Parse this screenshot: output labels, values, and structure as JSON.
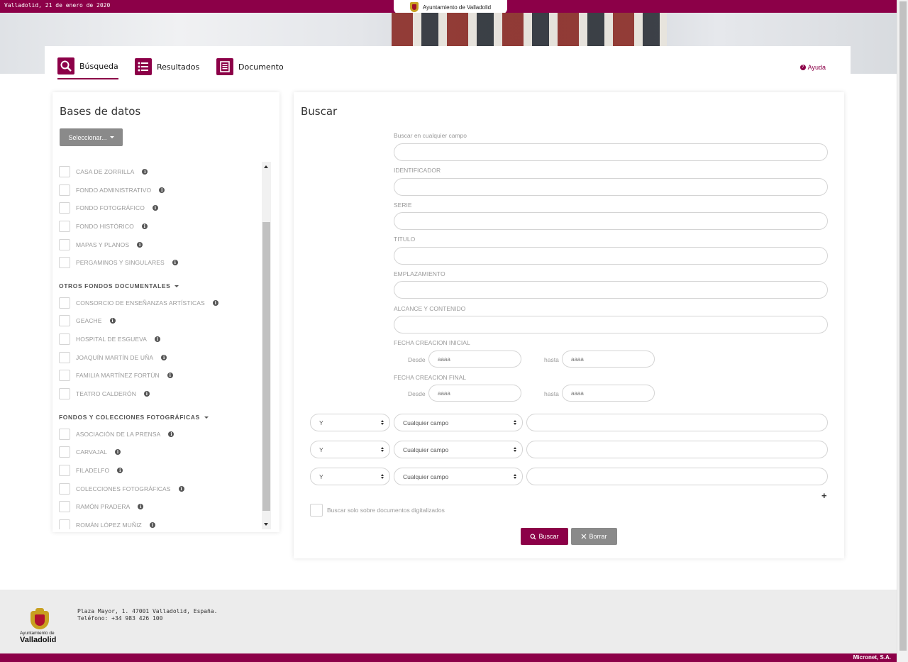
{
  "topbar": {
    "date": "Valladolid, 21 de enero de 2020",
    "site_name": "Ayuntamiento de Valladolid"
  },
  "nav": {
    "tabs": [
      {
        "label": "Búsqueda",
        "icon": "search-icon",
        "active": true
      },
      {
        "label": "Resultados",
        "icon": "list-icon",
        "active": false
      },
      {
        "label": "Documento",
        "icon": "document-icon",
        "active": false
      }
    ],
    "help": "Ayuda"
  },
  "databases": {
    "title": "Bases de datos",
    "select_label": "Seleccionar...",
    "items": [
      "CASA DE ZORRILLA",
      "FONDO ADMINISTRATIVO",
      "FONDO FOTOGRÁFICO",
      "FONDO HISTÓRICO",
      "MAPAS Y PLANOS",
      "PERGAMINOS Y SINGULARES"
    ],
    "groups": [
      {
        "title": "OTROS FONDOS DOCUMENTALES",
        "items": [
          "CONSORCIO DE ENSEÑANZAS ARTÍSTICAS",
          "GEACHE",
          "HOSPITAL DE ESGUEVA",
          "JOAQUÍN MARTÍN DE UÑA",
          "FAMILIA MARTÍNEZ FORTÚN",
          "TEATRO CALDERÓN"
        ]
      },
      {
        "title": "FONDOS Y COLECCIONES FOTOGRÁFICAS",
        "items": [
          "ASOCIACIÓN DE LA PRENSA",
          "CARVAJAL",
          "FILADELFO",
          "COLECCIONES FOTOGRÁFICAS",
          "RAMÓN PRADERA",
          "ROMÁN LÓPEZ MUÑIZ"
        ]
      }
    ]
  },
  "search": {
    "title": "Buscar",
    "fields": [
      {
        "label": "Buscar en cualquier campo",
        "value": ""
      },
      {
        "label": "IDENTIFICADOR",
        "value": ""
      },
      {
        "label": "SERIE",
        "value": ""
      },
      {
        "label": "TITULO",
        "value": ""
      },
      {
        "label": "EMPLAZAMIENTO",
        "value": ""
      },
      {
        "label": "ALCANCE Y CONTENIDO",
        "value": ""
      }
    ],
    "date_ranges": [
      {
        "label": "FECHA CREACION INICIAL",
        "from_label": "Desde",
        "to_label": "hasta",
        "from_placeholder": "aaaa",
        "to_placeholder": "aaaa"
      },
      {
        "label": "FECHA CREACION FINAL",
        "from_label": "Desde",
        "to_label": "hasta",
        "from_placeholder": "aaaa",
        "to_placeholder": "aaaa"
      }
    ],
    "criteria_rows": [
      {
        "operator": "Y",
        "field": "Cualquier campo",
        "value": ""
      },
      {
        "operator": "Y",
        "field": "Cualquier campo",
        "value": ""
      },
      {
        "operator": "Y",
        "field": "Cualquier campo",
        "value": ""
      }
    ],
    "add_row": "+",
    "digitized_only": "Buscar solo sobre documentos digitalizados",
    "buttons": {
      "search": "Buscar",
      "clear": "Borrar"
    }
  },
  "footer": {
    "org_line1": "Ayuntamiento de",
    "org_line2": "Valladolid",
    "address": "Plaza Mayor, 1. 47001 Valladolid, España.",
    "phone": "Teléfono: +34 983 426 100",
    "brand": "Micronet, S.A."
  },
  "colors": {
    "accent": "#8c0048",
    "grey_button": "#8a8a8a"
  }
}
